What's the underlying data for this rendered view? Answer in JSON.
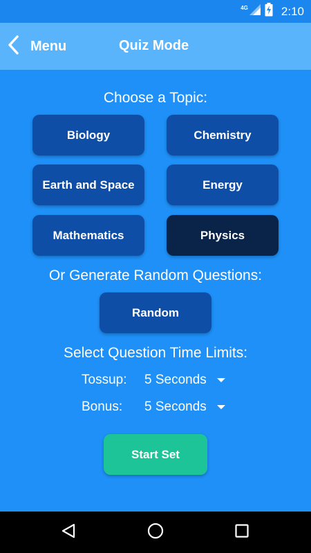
{
  "status_bar": {
    "network": "4G",
    "time": "2:10"
  },
  "app_bar": {
    "back_label": "Menu",
    "title": "Quiz Mode"
  },
  "topics": {
    "heading": "Choose a Topic:",
    "items": [
      {
        "label": "Biology",
        "selected": false
      },
      {
        "label": "Chemistry",
        "selected": false
      },
      {
        "label": "Earth and Space",
        "selected": false
      },
      {
        "label": "Energy",
        "selected": false
      },
      {
        "label": "Mathematics",
        "selected": false
      },
      {
        "label": "Physics",
        "selected": true
      }
    ]
  },
  "random": {
    "heading": "Or Generate Random Questions:",
    "button_label": "Random"
  },
  "time_limits": {
    "heading": "Select Question Time Limits:",
    "tossup": {
      "label": "Tossup:",
      "value": "5 Seconds"
    },
    "bonus": {
      "label": "Bonus:",
      "value": "5 Seconds"
    }
  },
  "start_button_label": "Start Set",
  "colors": {
    "background": "#1E90F7",
    "app_bar": "#5AB4FB",
    "tile": "#0F4EA6",
    "tile_selected": "#0A2349",
    "start_button": "#1DC497"
  },
  "icons": {
    "back": "chevron-left-icon",
    "dropdown": "triangle-down-icon",
    "nav_back": "triangle-back-icon",
    "nav_home": "circle-home-icon",
    "nav_recents": "square-recents-icon"
  }
}
